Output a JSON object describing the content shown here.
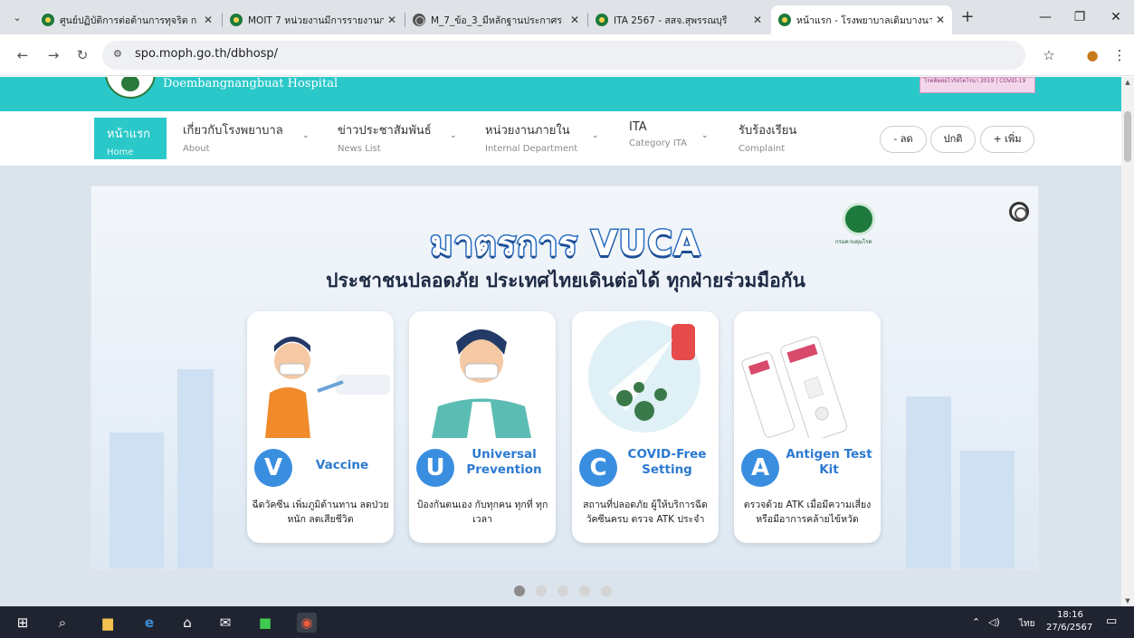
{
  "browser": {
    "tabs": [
      {
        "title": "ศูนย์ปฏิบัติการต่อต้านการทุจริต ก",
        "favicon": "green-seal-icon"
      },
      {
        "title": "MOIT 7 หน่วยงานมีการรายงานก",
        "favicon": "green-seal-icon"
      },
      {
        "title": "M_7_ข้อ_3_มีหลักฐานประกาศร",
        "favicon": "globe-icon"
      },
      {
        "title": "ITA 2567 - สสจ.สุพรรณบุรี",
        "favicon": "green-seal-icon"
      },
      {
        "title": "หน้าแรก - โรงพยาบาลเดิมบางนา",
        "favicon": "green-seal-icon",
        "active": true
      }
    ],
    "url": "spo.moph.go.th/dbhosp/"
  },
  "site": {
    "hospital_name": "Doembangnangbuat Hospital",
    "banner_text": "โรคติดต่อไวรัสโคโรนา 2019 | COVID-19",
    "nav": [
      {
        "th": "หน้าแรก",
        "en": "Home",
        "active": true
      },
      {
        "th": "เกี่ยวกับโรงพยาบาล",
        "en": "About"
      },
      {
        "th": "ข่าวประชาสัมพันธ์",
        "en": "News List"
      },
      {
        "th": "หน่วยงานภายใน",
        "en": "Internal Department"
      },
      {
        "th": "ITA",
        "en": "Category ITA"
      },
      {
        "th": "รับร้องเรียน",
        "en": "Complaint"
      }
    ],
    "font_controls": {
      "decrease": "- ลด",
      "normal": "ปกติ",
      "increase": "+ เพิ่ม"
    }
  },
  "hero": {
    "title": "มาตรการ VUCA",
    "subtitle": "ประชาชนปลอดภัย ประเทศไทยเดินต่อได้ ทุกฝ่ายร่วมมือกัน",
    "dept_logo_text": "กรมควบคุมโรค",
    "cards": [
      {
        "letter": "V",
        "word": "Vaccine",
        "desc": "ฉีดวัคซีน เพิ่มภูมิต้านทาน ลดป่วยหนัก ลดเสียชีวิต"
      },
      {
        "letter": "U",
        "word": "Universal Prevention",
        "desc": "ป้องกันตนเอง กับทุกคน ทุกที่ ทุกเวลา"
      },
      {
        "letter": "C",
        "word": "COVID-Free Setting",
        "desc": "สถานที่ปลอดภัย ผู้ให้บริการฉีดวัคซีนครบ ตรวจ ATK ประจำ"
      },
      {
        "letter": "A",
        "word": "Antigen Test Kit",
        "desc": "ตรวจด้วย ATK เมื่อมีความเสี่ยง หรือมีอาการคล้ายไข้หวัด"
      }
    ],
    "slides_total": 5,
    "slide_active": 1
  },
  "taskbar": {
    "language": "ไทย",
    "time": "18:16",
    "date": "27/6/2567"
  },
  "colors": {
    "accent": "#2bc8c9",
    "vuca_blue": "#3a8ee0"
  }
}
